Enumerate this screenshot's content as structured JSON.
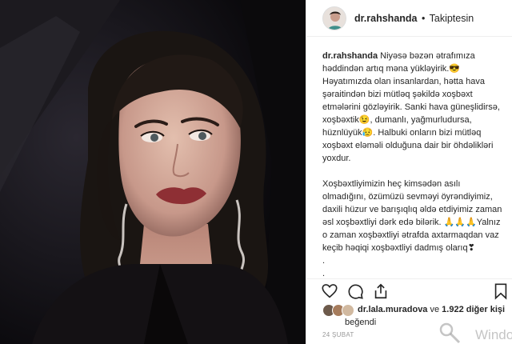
{
  "post": {
    "username": "dr.rahshanda",
    "separator": "•",
    "follow_status": "Takiptesin"
  },
  "caption": {
    "user": "dr.rahshanda",
    "paragraph1": "Niyəsə bəzən ətrafımıza həddindən artıq məna yükləyirik.😎 Həyatımızda olan insanlardan, hətta hava şəraitindən bizi mütləq şəkildə xoşbəxt etmələrini gözləyirik. Sanki hava güneşlidirsə, xoşbəxtik😉, dumanlı, yağmurludursa, hüznlüyük😥. Halbuki onların bizi mütləq xoşbəxt eləməli olduğuna dair bir öhdəlikləri yoxdur.",
    "paragraph2": "Xoşbəxtliyimizin heç kimsədən asılı olmadığını, özümüzü sevməyi öyrəndiyimiz, daxili hüzur ve barışıqlıq əldə etdiyimiz zaman əsl xoşbəxtliyi dərk edə bilərik. 🙏🙏🙏Yalnız o zaman xoşbəxtliyi ətrafda axtarmaqdan vaz keçib həqiqi xoşbəxtliyi dadmış olarıq❣",
    "dot1": ".",
    "dot2": "."
  },
  "actions": {
    "like_icon": "heart-icon",
    "comment_icon": "comment-icon",
    "share_icon": "share-icon",
    "save_icon": "bookmark-icon"
  },
  "likes": {
    "liker": "dr.lala.muradova",
    "connector": " ve ",
    "others": "1.922 diğer kişi",
    "suffix": "beğendi"
  },
  "date": "24 ŞUBAT",
  "watermark": "Windo",
  "colors": {
    "text": "#262626",
    "muted": "#999999",
    "border": "#efefef",
    "photo_bg": "#0e0c10"
  }
}
